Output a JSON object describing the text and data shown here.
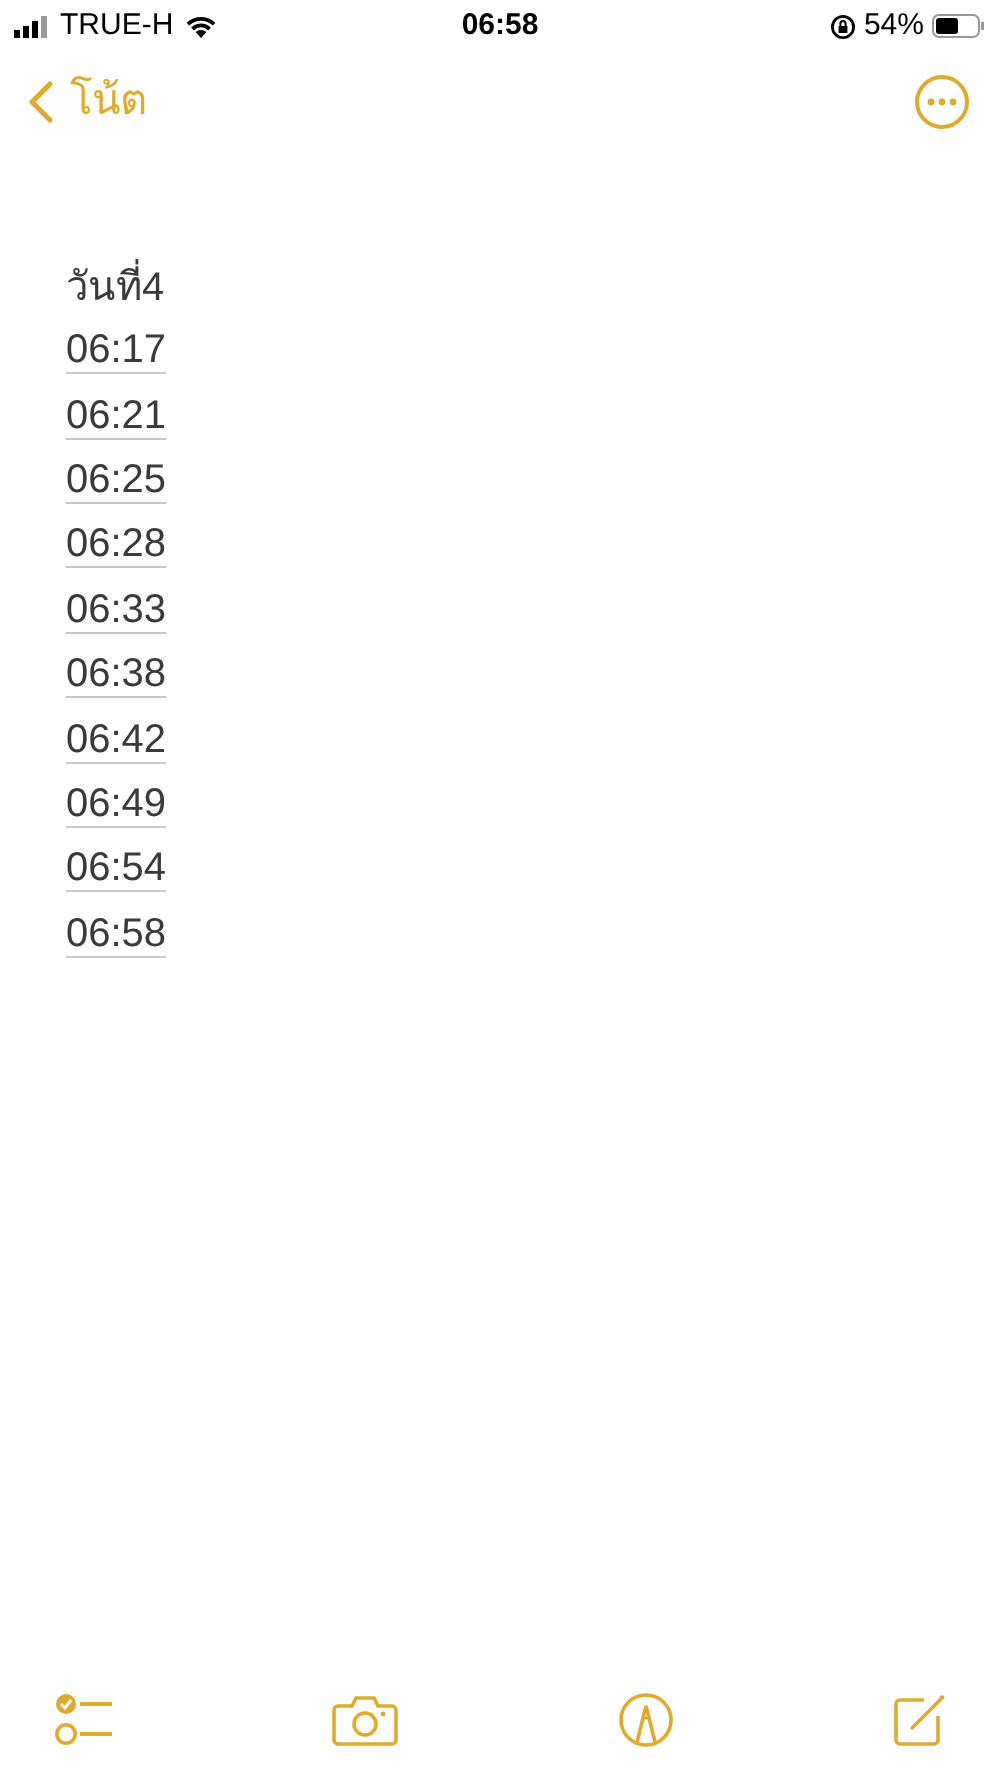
{
  "status_bar": {
    "carrier": "TRUE-H",
    "time": "06:58",
    "battery": "54%"
  },
  "nav": {
    "back_label": "โน้ต"
  },
  "note": {
    "lines": [
      {
        "kind": "blank"
      },
      {
        "kind": "blank"
      },
      {
        "kind": "heading",
        "text": "วันที่4"
      },
      {
        "kind": "time",
        "text": "06:17"
      },
      {
        "kind": "time",
        "text": "06:21"
      },
      {
        "kind": "time",
        "text": "06:25"
      },
      {
        "kind": "time",
        "text": "06:28"
      },
      {
        "kind": "time",
        "text": "06:33"
      },
      {
        "kind": "time",
        "text": "06:38"
      },
      {
        "kind": "time",
        "text": "06:42"
      },
      {
        "kind": "time",
        "text": "06:49"
      },
      {
        "kind": "time",
        "text": "06:54"
      },
      {
        "kind": "time",
        "text": "06:58"
      }
    ]
  }
}
